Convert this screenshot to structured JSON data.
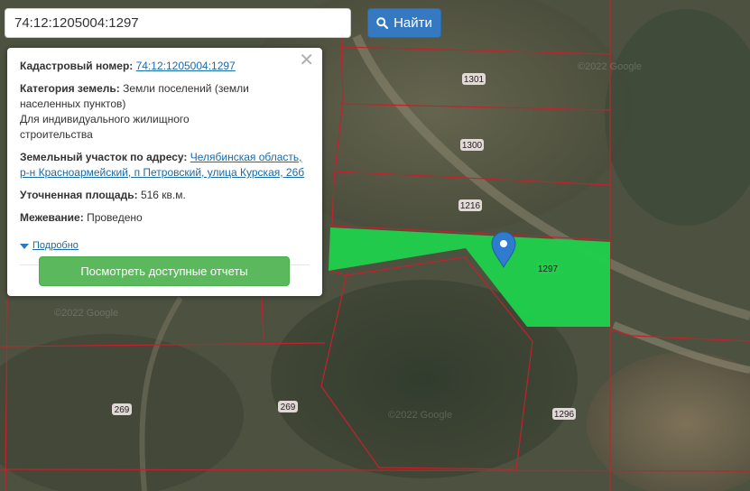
{
  "search": {
    "value": "74:12:1205004:1297",
    "button_label": "Найти"
  },
  "popup": {
    "cadastral_label": "Кадастровый номер:",
    "cadastral_value": "74:12:1205004:1297",
    "category_label": "Категория земель:",
    "category_value": "Земли поселений (земли населенных пунктов)",
    "usage": "Для индивидуального жилищного строительства",
    "address_label": "Земельный участок по адресу:",
    "address_value": "Челябинская область, р-н Красноармейский, п Петровский, улица Курская, 26б",
    "area_label": "Уточненная площадь:",
    "area_value": "516 кв.м.",
    "survey_label": "Межевание:",
    "survey_value": "Проведено",
    "details_link": "Подробно",
    "report_button": "Посмотреть доступные отчеты"
  },
  "map": {
    "selected_fill": "#1fcf4b",
    "boundary_color": "#c2222d",
    "plot_labels": [
      "1301",
      "1300",
      "1216",
      "1297",
      "269",
      "269",
      "1296"
    ],
    "watermarks": [
      "©2022 Google",
      "©2022 Google",
      "©2022 Google"
    ]
  }
}
